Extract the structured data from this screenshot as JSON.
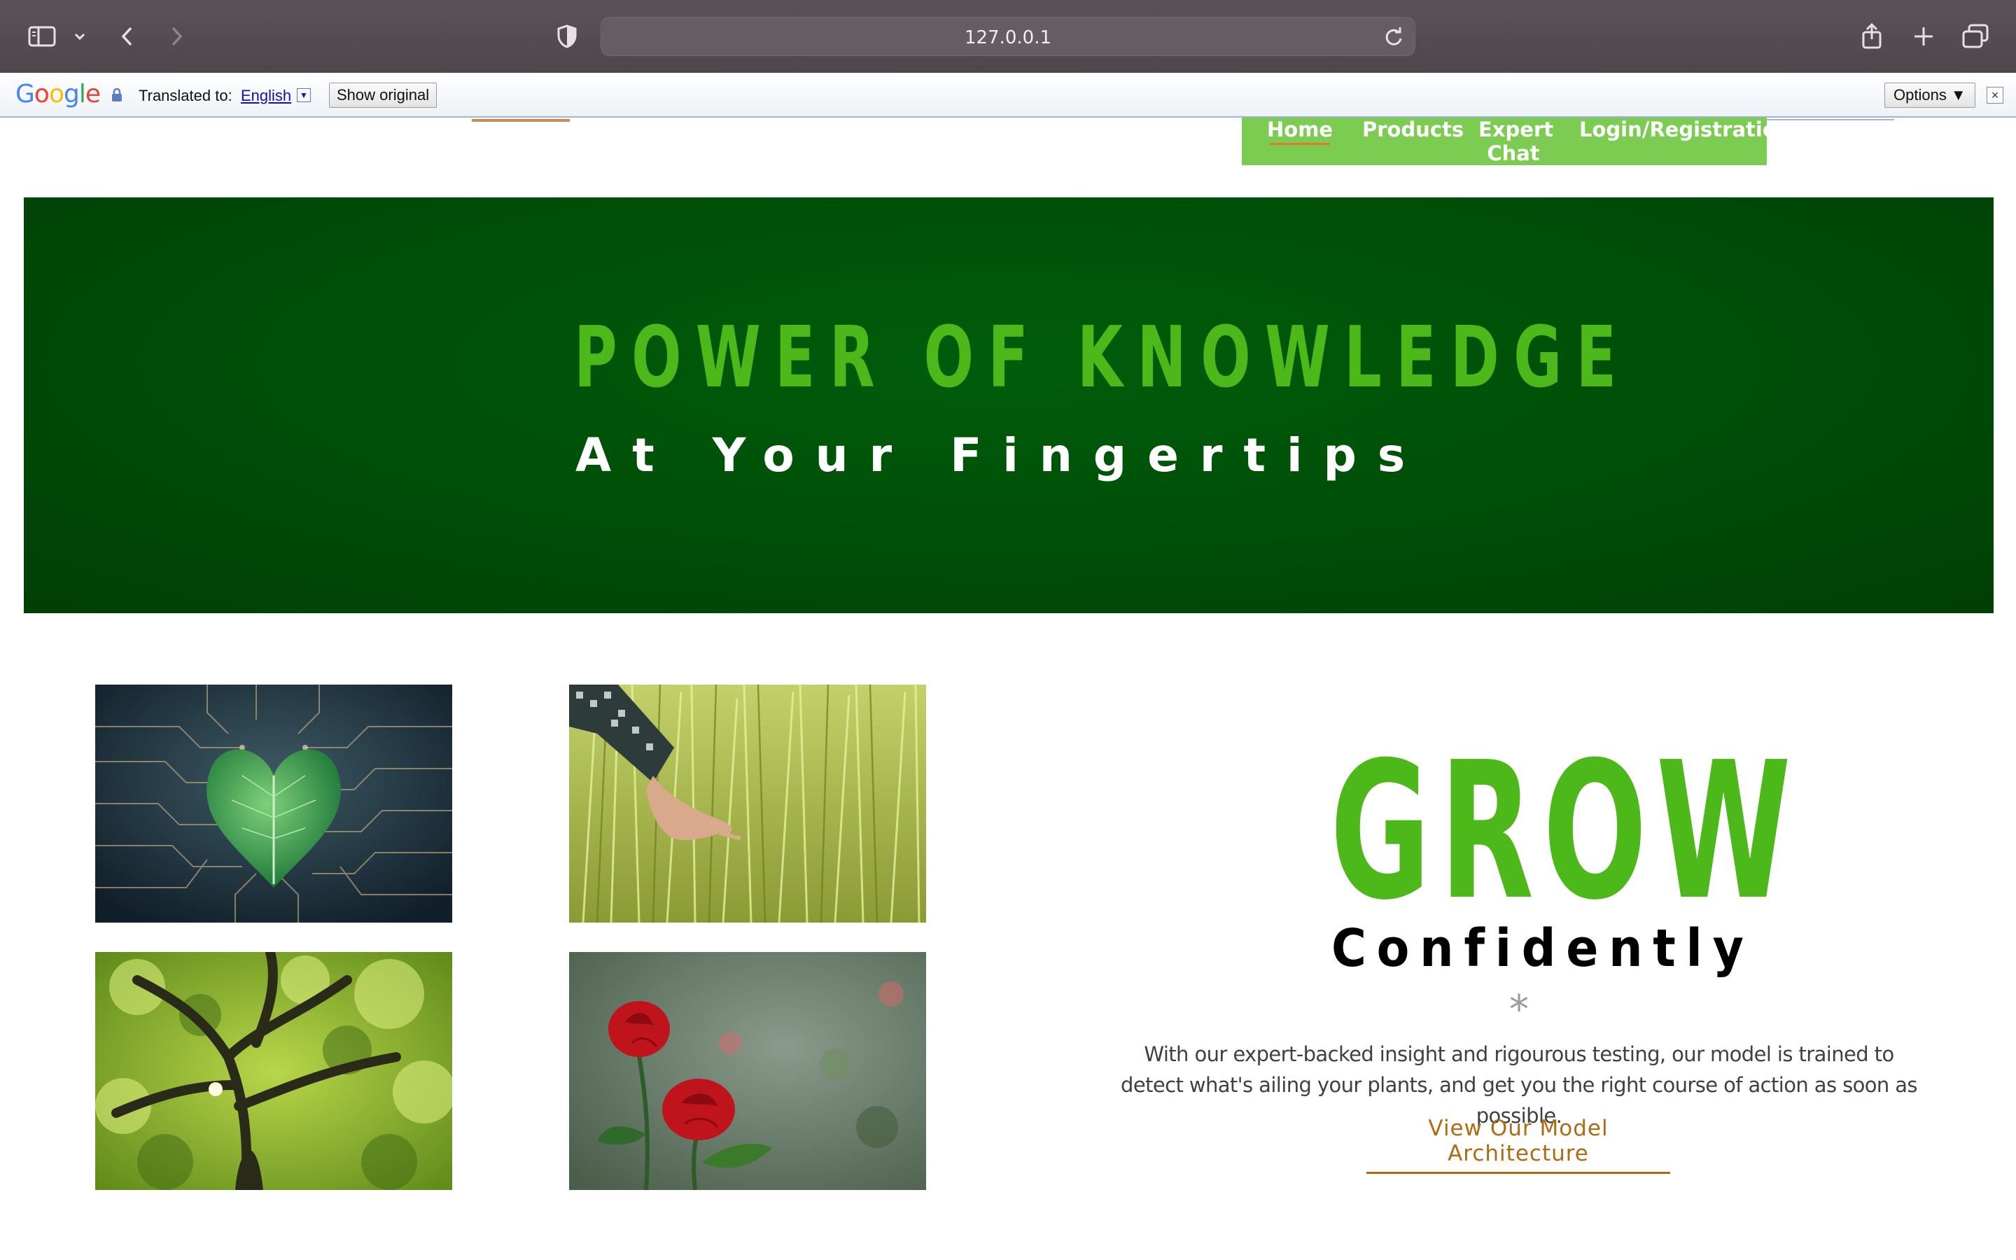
{
  "browser": {
    "url": "127.0.0.1"
  },
  "translate_bar": {
    "logo": "Google",
    "translated_label": "Translated to:",
    "language": "English",
    "show_original": "Show original",
    "options": "Options ▼"
  },
  "nav": {
    "items": [
      {
        "label": "Home"
      },
      {
        "label": "Products"
      },
      {
        "label": "Expert Chat"
      },
      {
        "label": "Login/Registration"
      }
    ]
  },
  "hero": {
    "title": "POWER OF KNOWLEDGE",
    "subtitle": "At Your Fingertips"
  },
  "grow": {
    "title": "GROW",
    "subtitle": "Confidently",
    "divider": "*",
    "description": "With our expert-backed insight and rigourous testing, our model is trained to detect what's ailing your plants, and get you the right course of action as soon as possible.",
    "link": "View Our Model Architecture"
  },
  "colors": {
    "accent_green": "#4cb819",
    "nav_green": "#7ccc52",
    "hero_green": "#004d08",
    "link_brown": "#b06a12"
  }
}
